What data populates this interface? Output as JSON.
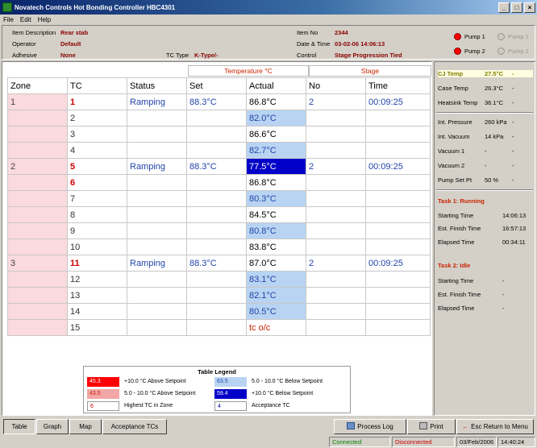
{
  "window": {
    "title": "Novatech Controls Hot Bonding Controller HBC4301",
    "menu": [
      "File",
      "Edit",
      "Help"
    ]
  },
  "info": {
    "item_description_label": "Item Description",
    "item_description": "Rear stab",
    "operator_label": "Operator",
    "operator": "Default",
    "adhesive_label": "Adhesive",
    "adhesive": "None",
    "tc_type_label": "TC Type",
    "tc_type": "K-Type/-",
    "item_no_label": "Item No",
    "item_no": "2344",
    "date_time_label": "Date & Time",
    "date_time": "03-02-06 14:06:13",
    "control_label": "Control",
    "control": "Stage Progression Tied"
  },
  "pumps": [
    {
      "label": "Pump 1",
      "on": true
    },
    {
      "label": "Pump 1",
      "on": false
    },
    {
      "label": "Pump 2",
      "on": true
    },
    {
      "label": "Pump 2",
      "on": false
    }
  ],
  "table": {
    "group_temperature": "Temperature °C",
    "group_stage": "Stage",
    "headers": [
      "Zone",
      "TC",
      "Status",
      "Set",
      "Actual",
      "No",
      "Time"
    ],
    "rows": [
      {
        "zone": "1",
        "tc": "1",
        "tc_high": true,
        "status": "Ramping",
        "set": "88.3°C",
        "actual": "86.8°C",
        "actual_style": "none",
        "no": "2",
        "time": "00:09:25"
      },
      {
        "zone": "",
        "tc": "2",
        "tc_high": false,
        "status": "",
        "set": "",
        "actual": "82.0°C",
        "actual_style": "light-blue",
        "no": "",
        "time": ""
      },
      {
        "zone": "",
        "tc": "3",
        "tc_high": false,
        "status": "",
        "set": "",
        "actual": "86.6°C",
        "actual_style": "none",
        "no": "",
        "time": ""
      },
      {
        "zone": "",
        "tc": "4",
        "tc_high": false,
        "status": "",
        "set": "",
        "actual": "82.7°C",
        "actual_style": "light-blue",
        "no": "",
        "time": ""
      },
      {
        "zone": "2",
        "tc": "5",
        "tc_high": true,
        "status": "Ramping",
        "set": "88.3°C",
        "actual": "77.5°C",
        "actual_style": "dark-blue",
        "no": "2",
        "time": "00:09:25"
      },
      {
        "zone": "",
        "tc": "6",
        "tc_high": true,
        "status": "",
        "set": "",
        "actual": "86.8°C",
        "actual_style": "none",
        "no": "",
        "time": ""
      },
      {
        "zone": "",
        "tc": "7",
        "tc_high": false,
        "status": "",
        "set": "",
        "actual": "80.3°C",
        "actual_style": "light-blue",
        "no": "",
        "time": ""
      },
      {
        "zone": "",
        "tc": "8",
        "tc_high": false,
        "status": "",
        "set": "",
        "actual": "84.5°C",
        "actual_style": "none",
        "no": "",
        "time": ""
      },
      {
        "zone": "",
        "tc": "9",
        "tc_high": false,
        "status": "",
        "set": "",
        "actual": "80.8°C",
        "actual_style": "light-blue",
        "no": "",
        "time": ""
      },
      {
        "zone": "",
        "tc": "10",
        "tc_high": false,
        "status": "",
        "set": "",
        "actual": "83.8°C",
        "actual_style": "none",
        "no": "",
        "time": ""
      },
      {
        "zone": "3",
        "tc": "11",
        "tc_high": true,
        "status": "Ramping",
        "set": "88.3°C",
        "actual": "87.0°C",
        "actual_style": "none",
        "no": "2",
        "time": "00:09:25"
      },
      {
        "zone": "",
        "tc": "12",
        "tc_high": false,
        "status": "",
        "set": "",
        "actual": "83.1°C",
        "actual_style": "light-blue",
        "no": "",
        "time": ""
      },
      {
        "zone": "",
        "tc": "13",
        "tc_high": false,
        "status": "",
        "set": "",
        "actual": "82.1°C",
        "actual_style": "light-blue",
        "no": "",
        "time": ""
      },
      {
        "zone": "",
        "tc": "14",
        "tc_high": false,
        "status": "",
        "set": "",
        "actual": "80.5°C",
        "actual_style": "light-blue",
        "no": "",
        "time": ""
      },
      {
        "zone": "",
        "tc": "15",
        "tc_high": false,
        "status": "",
        "set": "",
        "actual": "tc o/c",
        "actual_style": "error",
        "no": "",
        "time": ""
      }
    ]
  },
  "legend": {
    "title": "Table Legend",
    "items": [
      {
        "swatch": "45.3",
        "text": "+10.0 °C Above Setpoint",
        "bg": "#ff0000",
        "fg": "#ffffff"
      },
      {
        "swatch": "43.5",
        "text": "5.0 - 10.0 °C Above Setpoint",
        "bg": "#f2a6a6",
        "fg": "#cc2200"
      },
      {
        "swatch": "6",
        "text": "Highest TC in Zone",
        "bg": "#ffffff",
        "fg": "#cc0000"
      },
      {
        "swatch": "63.5",
        "text": "5.0 - 10.0 °C Below Setpoint",
        "bg": "#b8d4f2",
        "fg": "#2244aa"
      },
      {
        "swatch": "59.4",
        "text": "+10.0 °C Below Setpoint",
        "bg": "#0000c8",
        "fg": "#ffffff"
      },
      {
        "swatch": "4",
        "text": "Acceptance TC",
        "bg": "#ffffff",
        "fg": "#0000aa"
      }
    ]
  },
  "side": {
    "cj_temp_label": "CJ Temp",
    "cj_temp": "27.5°C",
    "cj_temp_extra": "-",
    "case_temp_label": "Case Temp",
    "case_temp": "26.3°C",
    "case_temp_extra": "-",
    "heatsink_label": "Heatsink Temp",
    "heatsink": "36.1°C",
    "heatsink_extra": "-",
    "int_pressure_label": "Int. Pressure",
    "int_pressure": "260 kPa",
    "int_pressure_extra": "-",
    "int_vacuum_label": "Int. Vacuum",
    "int_vacuum": "14 kPa",
    "int_vacuum_extra": "-",
    "vacuum1_label": "Vacuum 1",
    "vacuum1": "-",
    "vacuum1_extra": "-",
    "vacuum2_label": "Vacuum 2",
    "vacuum2": "-",
    "vacuum2_extra": "-",
    "pump_set_label": "Pump Set Pt",
    "pump_set": "50 %",
    "pump_set_extra": "-",
    "task1_title": "Task 1: Running",
    "t1_start_label": "Starting Time",
    "t1_start": "14:06:13",
    "t1_finish_label": "Est. Finish Time",
    "t1_finish": "16:57:13",
    "t1_elapsed_label": "Elapsed Time",
    "t1_elapsed": "00:34:11",
    "task2_title": "Task 2: Idle",
    "t2_start_label": "Starting Time",
    "t2_start": "-",
    "t2_finish_label": "Est. Finish Time",
    "t2_finish": "-",
    "t2_elapsed_label": "Elapsed Time",
    "t2_elapsed": "-"
  },
  "buttons": {
    "table": "Table",
    "graph": "Graph",
    "map": "Map",
    "acceptance": "Acceptance TCs",
    "process_log": "Process Log",
    "print": "Print",
    "return_menu": "Esc Return to Menu"
  },
  "statusbar": {
    "connected": "Connected",
    "disconnected": "Disconnected",
    "date": "03/Feb/2006",
    "time": "14:40:24",
    "connected_color": "#008000",
    "disconnected_color": "#cc0000"
  }
}
